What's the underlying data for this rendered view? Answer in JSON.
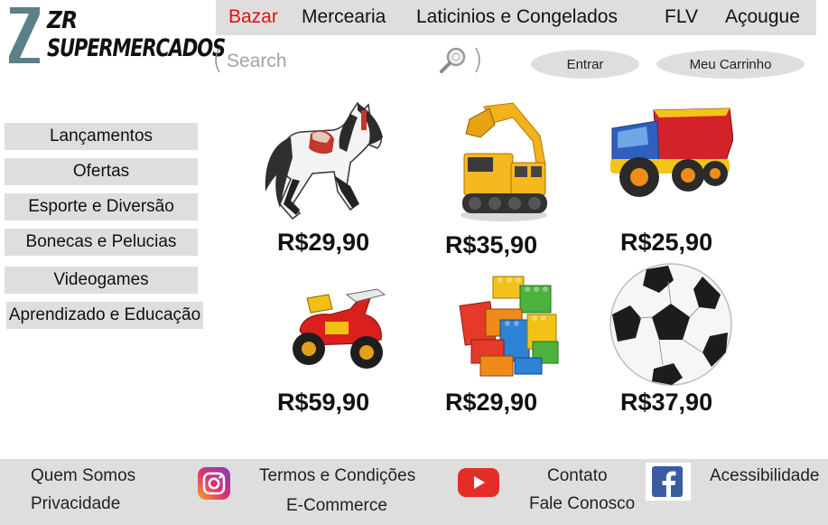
{
  "logo": {
    "line1": "ZR",
    "line2": "SUPERMERCADOS"
  },
  "nav": [
    {
      "label": "Bazar"
    },
    {
      "label": "Mercearia"
    },
    {
      "label": "Laticinios e Congelados"
    },
    {
      "label": "FLV"
    },
    {
      "label": "Açougue"
    }
  ],
  "search": {
    "placeholder": "Search",
    "open_paren": "(",
    "close_paren": ")"
  },
  "buttons": {
    "login": "Entrar",
    "cart": "Meu Carrinho"
  },
  "sidebar": [
    {
      "label": "Lançamentos"
    },
    {
      "label": "Ofertas"
    },
    {
      "label": "Esporte e Diversão"
    },
    {
      "label": "Bonecas e Pelucias"
    },
    {
      "label": "Videogames"
    },
    {
      "label": "Aprendizado e Educação"
    }
  ],
  "products": [
    {
      "image": "toy-horse",
      "price": "R$29,90"
    },
    {
      "image": "toy-excavator",
      "price": "R$35,90"
    },
    {
      "image": "toy-dump-truck",
      "price": "R$25,90"
    },
    {
      "image": "toy-motorcycle",
      "price": "R$59,90"
    },
    {
      "image": "building-blocks",
      "price": "R$29,90"
    },
    {
      "image": "soccer-ball",
      "price": "R$37,90"
    }
  ],
  "footer": {
    "about": "Quem Somos",
    "privacy": "Privacidade",
    "terms": "Termos e Condições",
    "ecommerce": "E-Commerce",
    "contact": "Contato",
    "talk": "Fale Conosco",
    "accessibility": "Acessibilidade"
  },
  "colors": {
    "nav_active": "#e31010",
    "bar_gray": "#dedede"
  }
}
